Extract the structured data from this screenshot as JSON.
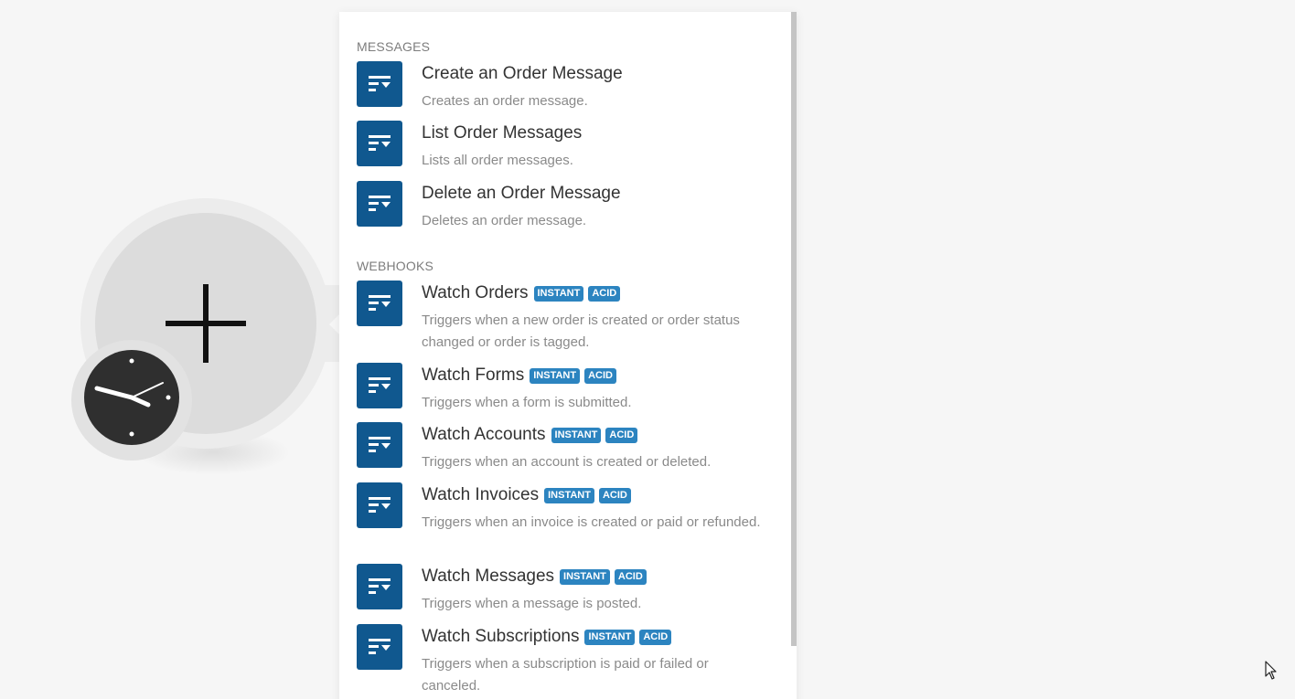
{
  "colors": {
    "tile_blue": "#10588f",
    "badge_blue": "#2c84c0",
    "canvas_bg": "#f6f6f6"
  },
  "panel": {
    "sections": [
      {
        "header": "MESSAGES",
        "items": [
          {
            "title": "Create an Order Message",
            "description": "Creates an order message.",
            "badges": []
          },
          {
            "title": "List Order Messages",
            "description": "Lists all order messages.",
            "badges": []
          },
          {
            "title": "Delete an Order Message",
            "description": "Deletes an order message.",
            "badges": []
          }
        ]
      },
      {
        "header": "WEBHOOKS",
        "items": [
          {
            "title": "Watch Orders",
            "description": "Triggers when a new order is created or order status changed or order is tagged.",
            "badges": [
              "INSTANT",
              "ACID"
            ]
          },
          {
            "title": "Watch Forms",
            "description": "Triggers when a form is submitted.",
            "badges": [
              "INSTANT",
              "ACID"
            ]
          },
          {
            "title": "Watch Accounts",
            "description": "Triggers when an account is created or deleted.",
            "badges": [
              "INSTANT",
              "ACID"
            ]
          },
          {
            "title": "Watch Invoices",
            "description": "Triggers when an invoice is created or paid or refunded.",
            "badges": [
              "INSTANT",
              "ACID"
            ]
          },
          {
            "title": "Watch Messages",
            "description": "Triggers when a message is posted.",
            "badges": [
              "INSTANT",
              "ACID"
            ]
          },
          {
            "title": "Watch Subscriptions",
            "description": "Triggers when a subscription is paid or failed or canceled.",
            "badges": [
              "INSTANT",
              "ACID"
            ]
          }
        ]
      }
    ]
  },
  "icons": {
    "module_tile": "app-module-icon",
    "add": "plus-icon",
    "schedule": "clock-icon",
    "pointer": "mouse-cursor-icon"
  }
}
